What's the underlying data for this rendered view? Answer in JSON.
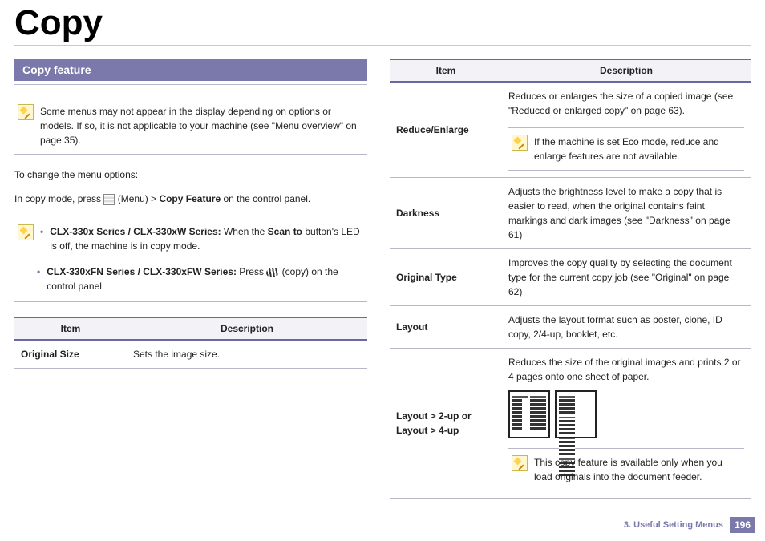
{
  "page_title": "Copy",
  "section_heading": "Copy feature",
  "note_top": "Some menus may not appear in the display depending on options or models. If so, it is not applicable to your machine (see \"Menu overview\" on page 35).",
  "para_intro": "To change the menu options:",
  "para_instr_pre": "In copy mode, press ",
  "para_instr_menu": "(Menu)",
  "para_instr_mid": " > ",
  "para_instr_feat": "Copy Feature",
  "para_instr_post": " on the control panel.",
  "series1_label": "CLX-330x Series / CLX-330xW Series:",
  "series1_text": " When the ",
  "series1_bold": "Scan to",
  "series1_tail": " button's LED is off, the machine is in copy mode.",
  "series2_label": "CLX-330xFN Series / CLX-330xFW Series:",
  "series2_text": " Press ",
  "series2_tail": " (copy) on the control panel.",
  "left_table": {
    "h1": "Item",
    "h2": "Description",
    "row1_item": "Original Size",
    "row1_desc": "Sets the image size."
  },
  "right_table": {
    "h1": "Item",
    "h2": "Description",
    "rows": [
      {
        "item": "Reduce/Enlarge",
        "desc": "Reduces or enlarges the size of a copied image (see \"Reduced or enlarged copy\" on page 63).",
        "note": "If the machine is set Eco mode, reduce and enlarge features are not available."
      },
      {
        "item": "Darkness",
        "desc": "Adjusts the brightness level to make a copy that is easier to read, when the original contains faint markings and dark images (see \"Darkness\" on page 61)"
      },
      {
        "item": "Original Type",
        "desc": "Improves the copy quality by selecting the document type for the current copy job (see \"Original\" on page 62)"
      },
      {
        "item": "Layout",
        "desc": "Adjusts the layout format such as poster, clone, ID copy, 2/4-up, booklet, etc."
      },
      {
        "item_a": "Layout",
        "item_gt1": " > ",
        "item_b": "2-up",
        "item_or": " or ",
        "item_c": "Layout",
        "item_gt2": " > ",
        "item_d": "4-up",
        "desc": "Reduces the size of the original images and prints 2 or 4 pages onto one sheet of paper.",
        "note": "This copy feature is available only when you load originals into the document feeder."
      }
    ]
  },
  "footer_chapter": "3.  Useful Setting Menus",
  "footer_page": "196"
}
